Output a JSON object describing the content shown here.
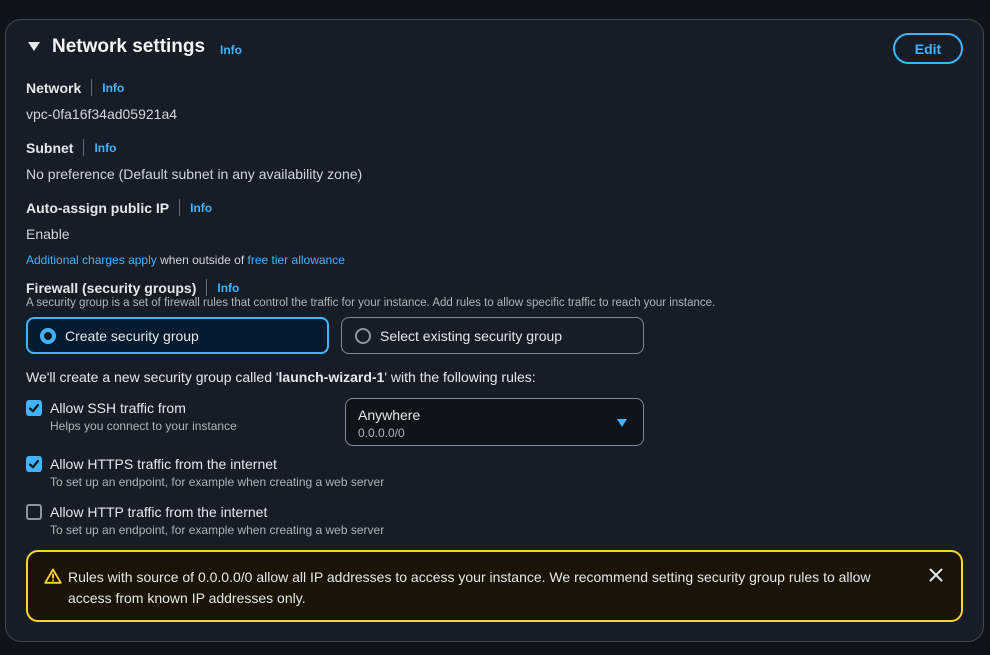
{
  "header": {
    "title": "Network settings",
    "info": "Info",
    "edit_label": "Edit"
  },
  "network": {
    "label": "Network",
    "info": "Info",
    "value": "vpc-0fa16f34ad05921a4"
  },
  "subnet": {
    "label": "Subnet",
    "info": "Info",
    "value": "No preference (Default subnet in any availability zone)"
  },
  "auto_ip": {
    "label": "Auto-assign public IP",
    "info": "Info",
    "value": "Enable",
    "note_link1": "Additional charges apply",
    "note_mid": " when outside of ",
    "note_link2": "free tier allowance"
  },
  "firewall": {
    "label": "Firewall (security groups)",
    "info": "Info",
    "description": "A security group is a set of firewall rules that control the traffic for your instance. Add rules to allow specific traffic to reach your instance.",
    "option_create": "Create security group",
    "option_existing": "Select existing security group",
    "create_note_prefix": "We'll create a new security group called '",
    "create_note_name": "launch-wizard-1",
    "create_note_suffix": "' with the following rules:"
  },
  "rules": {
    "ssh": {
      "title": "Allow SSH traffic from",
      "desc": "Helps you connect to your instance",
      "checked": true
    },
    "ssh_source": {
      "value": "Anywhere",
      "sub": "0.0.0.0/0"
    },
    "https": {
      "title": "Allow HTTPS traffic from the internet",
      "desc": "To set up an endpoint, for example when creating a web server",
      "checked": true
    },
    "http": {
      "title": "Allow HTTP traffic from the internet",
      "desc": "To set up an endpoint, for example when creating a web server",
      "checked": false
    }
  },
  "alert": {
    "message": "Rules with source of 0.0.0.0/0 allow all IP addresses to access your instance. We recommend setting security group rules to allow access from known IP addresses only."
  },
  "colors": {
    "accent": "#42b4ff",
    "warning": "#fbd332",
    "background": "#0f141a",
    "panel": "#161d26"
  },
  "icons": [
    "caret-down-icon",
    "check-icon",
    "warning-icon",
    "close-icon",
    "dropdown-caret-icon"
  ]
}
